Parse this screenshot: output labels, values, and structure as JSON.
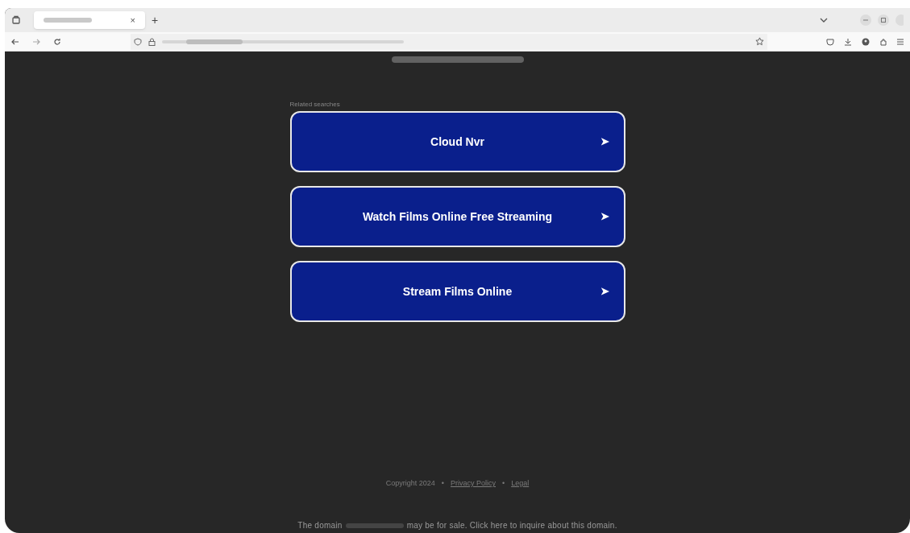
{
  "browser": {
    "tab_close": "×",
    "new_tab": "+"
  },
  "related_label": "Related searches",
  "searches": [
    {
      "label": "Cloud Nvr",
      "arrow": "➤"
    },
    {
      "label": "Watch Films Online Free Streaming",
      "arrow": "➤"
    },
    {
      "label": "Stream Films Online",
      "arrow": "➤"
    }
  ],
  "footer": {
    "copyright": "Copyright 2024",
    "separator": "•",
    "links": [
      "Privacy Policy",
      "Legal"
    ]
  },
  "sale_notice": {
    "before": "The domain",
    "after": "may be for sale. Click here to inquire about this domain."
  }
}
